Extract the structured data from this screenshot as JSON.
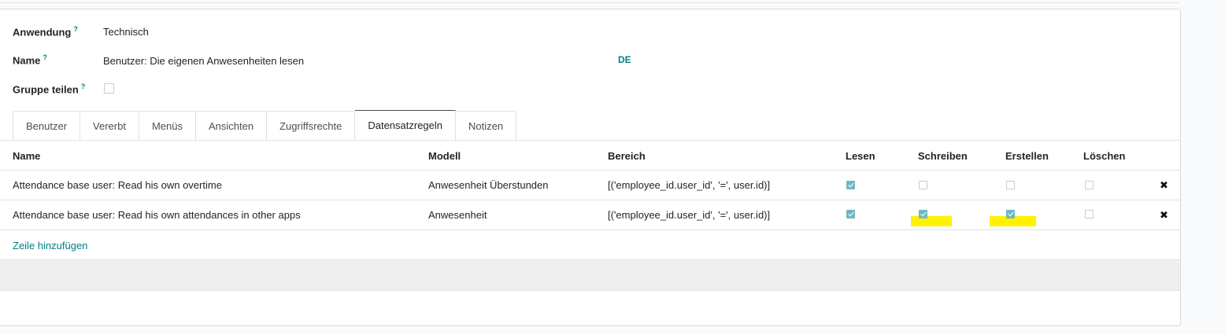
{
  "form": {
    "application": {
      "label": "Anwendung",
      "help": "?",
      "value": "Technisch"
    },
    "name": {
      "label": "Name",
      "help": "?",
      "value": "Benutzer: Die eigenen Anwesenheiten lesen",
      "lang": "DE"
    },
    "share_group": {
      "label": "Gruppe teilen",
      "help": "?",
      "checked": false
    }
  },
  "tabs": [
    {
      "label": "Benutzer",
      "active": false
    },
    {
      "label": "Vererbt",
      "active": false
    },
    {
      "label": "Menüs",
      "active": false
    },
    {
      "label": "Ansichten",
      "active": false
    },
    {
      "label": "Zugriffsrechte",
      "active": false
    },
    {
      "label": "Datensatzregeln",
      "active": true
    },
    {
      "label": "Notizen",
      "active": false
    }
  ],
  "table": {
    "columns": [
      "Name",
      "Modell",
      "Bereich",
      "Lesen",
      "Schreiben",
      "Erstellen",
      "Löschen"
    ],
    "rows": [
      {
        "name": "Attendance base user: Read his own overtime",
        "model": "Anwesenheit Überstunden",
        "domain": "[('employee_id.user_id', '=', user.id)]",
        "read": true,
        "write": false,
        "create": false,
        "unlink": false,
        "delete_icon": "✖"
      },
      {
        "name": "Attendance base user: Read his own attendances in other apps",
        "model": "Anwesenheit",
        "domain": "[('employee_id.user_id', '=', user.id)]",
        "read": true,
        "write": true,
        "create": true,
        "unlink": false,
        "delete_icon": "✖"
      }
    ],
    "add_line": "Zeile hinzufügen"
  },
  "colors": {
    "accent": "#017e84",
    "checkbox_checked": "#71b7bd",
    "highlight": "#fff200"
  }
}
